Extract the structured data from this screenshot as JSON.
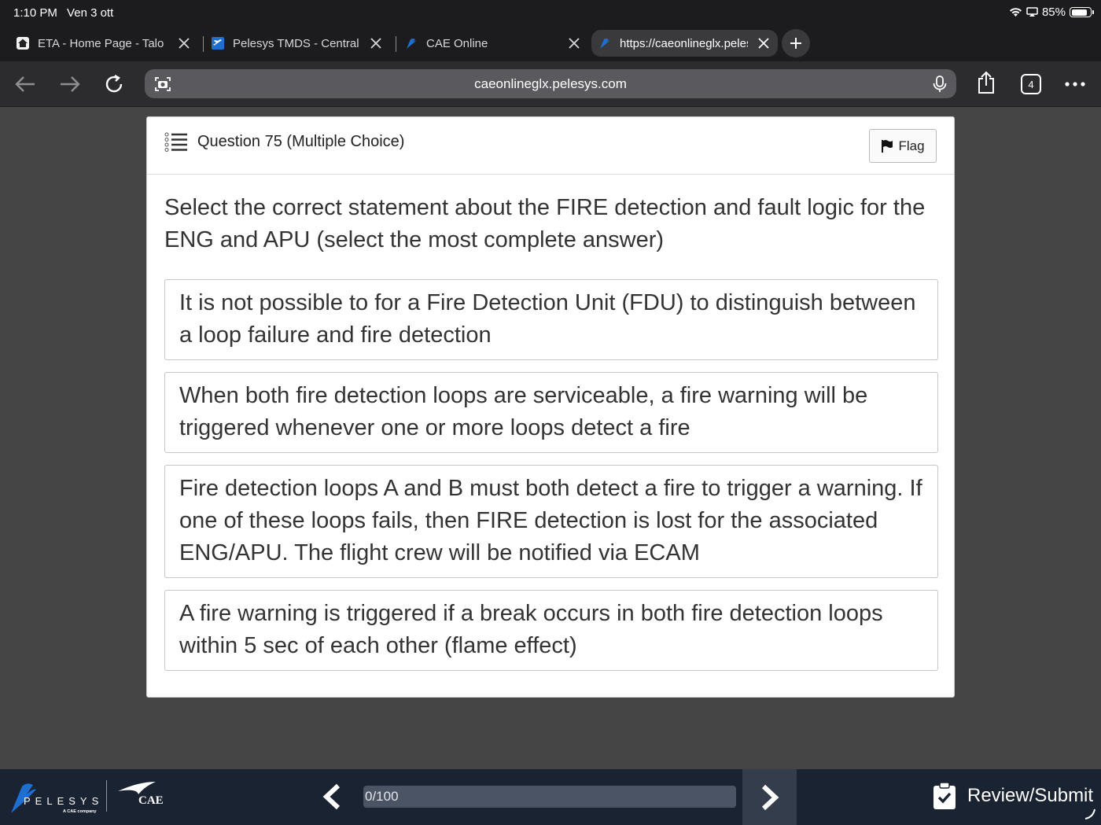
{
  "status_bar": {
    "time": "1:10 PM",
    "date": "Ven 3 ott",
    "battery": "85%",
    "battery_level": 0.85
  },
  "tabs": [
    {
      "title": "ETA - Home Page - Talon",
      "active": false
    },
    {
      "title": "Pelesys TMDS - Central",
      "active": false
    },
    {
      "title": "CAE Online",
      "active": false
    },
    {
      "title": "https://caeonlineglx.pelesys.com",
      "active": true
    }
  ],
  "toolbar": {
    "url": "caeonlineglx.pelesys.com",
    "tab_count": "4"
  },
  "question": {
    "header": "Question 75 (Multiple Choice)",
    "flag_label": "Flag",
    "text": "Select the correct statement about the FIRE detection and fault logic for the ENG and APU (select the most complete answer)",
    "options": [
      "It is not possible to for a Fire Detection Unit (FDU) to distinguish between a loop failure and fire detection",
      "When both fire detection loops are serviceable, a fire warning will be triggered whenever one or more loops detect a fire",
      "Fire detection loops A and B must both detect a fire to trigger a warning. If one of these loops fails, then FIRE detection is lost for the associated ENG/APU. The flight crew will be notified via ECAM",
      "A fire warning is triggered if a break occurs in both fire detection loops within 5 sec of each other (flame effect)"
    ]
  },
  "footer": {
    "brand": "PELESYS",
    "brand_sub": "A CAE company",
    "partner": "CAE",
    "progress_label": "0/100",
    "progress_value": 0,
    "review_label": "Review/Submit"
  },
  "colors": {
    "page_bg": "#454545",
    "footer_bg": "#1a2332",
    "brand_blue": "#1f6fd1"
  }
}
